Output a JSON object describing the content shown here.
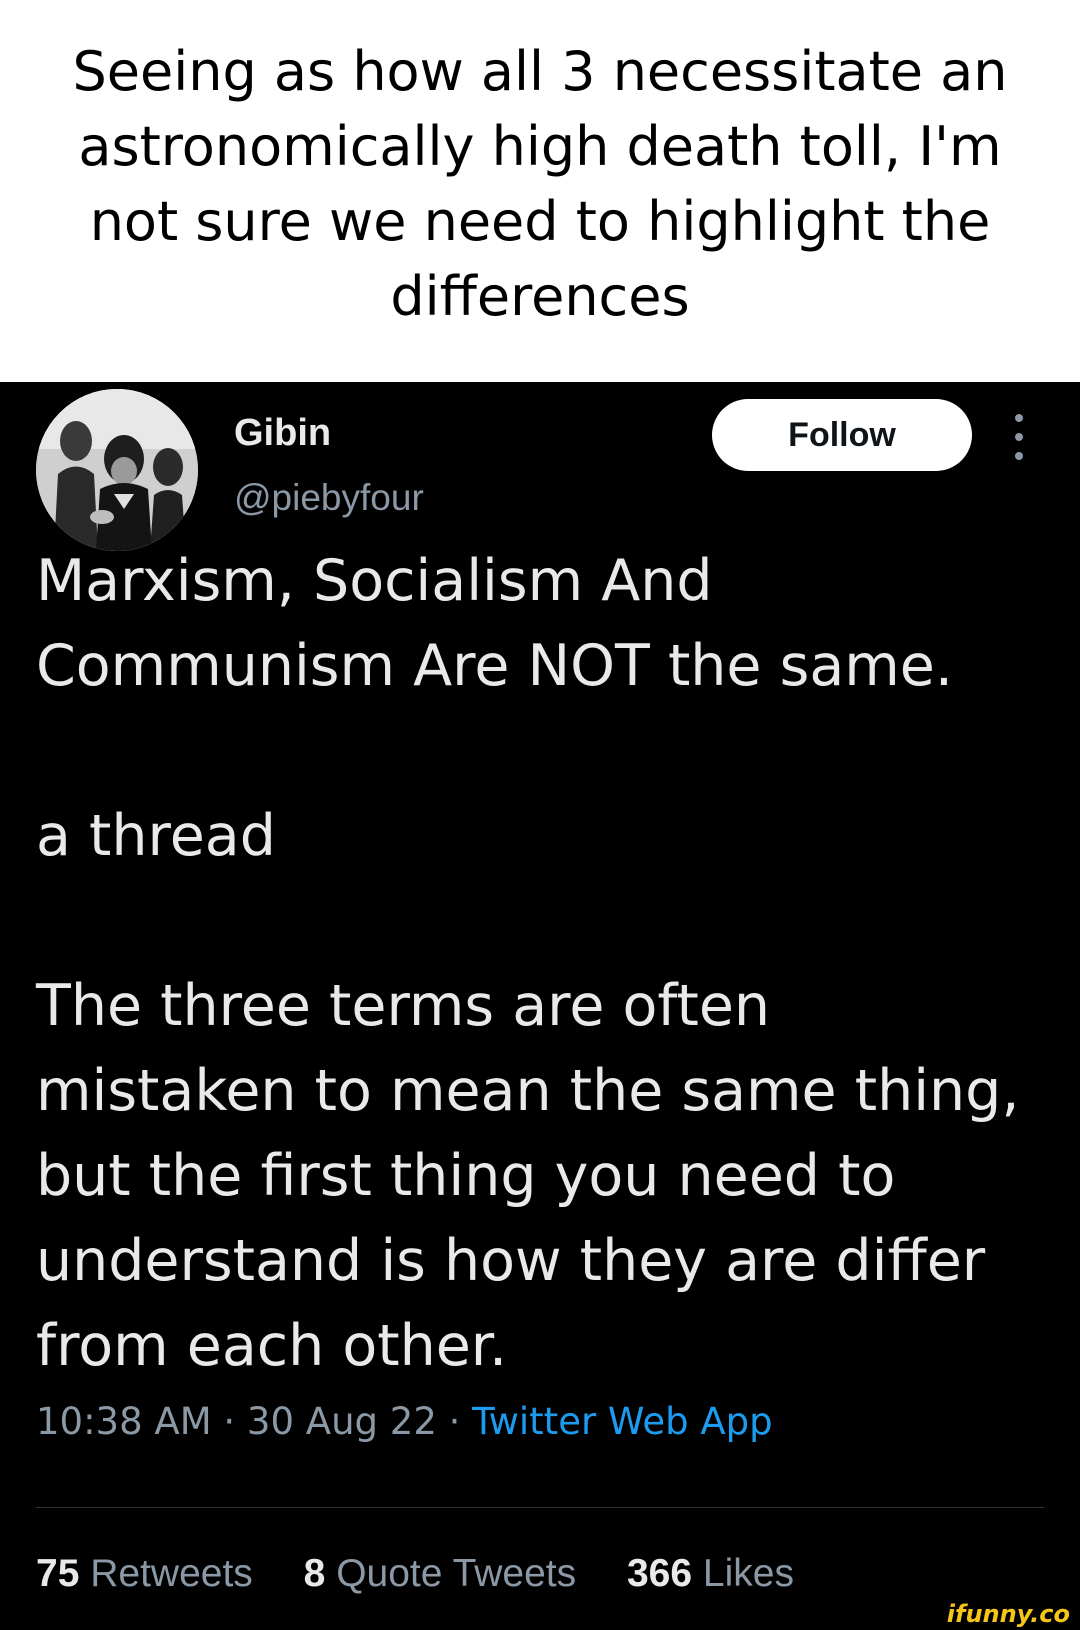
{
  "caption": {
    "text": "Seeing as how all 3 necessitate an astronomically high death toll, I'm not sure we need to highlight the differences"
  },
  "tweet": {
    "display_name": "Gibin",
    "handle": "@piebyfour",
    "follow_label": "Follow",
    "body": {
      "line1": "Marxism, Socialism And\nCommunism Are NOT the same.",
      "line2": "a thread",
      "line3": "The three terms are often\nmistaken to mean the same thing,\nbut the first thing you need to\nunderstand is how they are differ\nfrom each other."
    },
    "time": "10:38 AM",
    "separator": "·",
    "date": "30 Aug 22",
    "source": "Twitter Web App",
    "stats": {
      "retweets_count": "75",
      "retweets_label": "Retweets",
      "quotes_count": "8",
      "quotes_label": "Quote Tweets",
      "likes_count": "366",
      "likes_label": "Likes"
    }
  },
  "watermark": "ifunny.co",
  "colors": {
    "background": "#000000",
    "text": "#e7e9ea",
    "muted": "#8b98a5",
    "link": "#1d9bf0",
    "watermark": "#f5c518"
  }
}
